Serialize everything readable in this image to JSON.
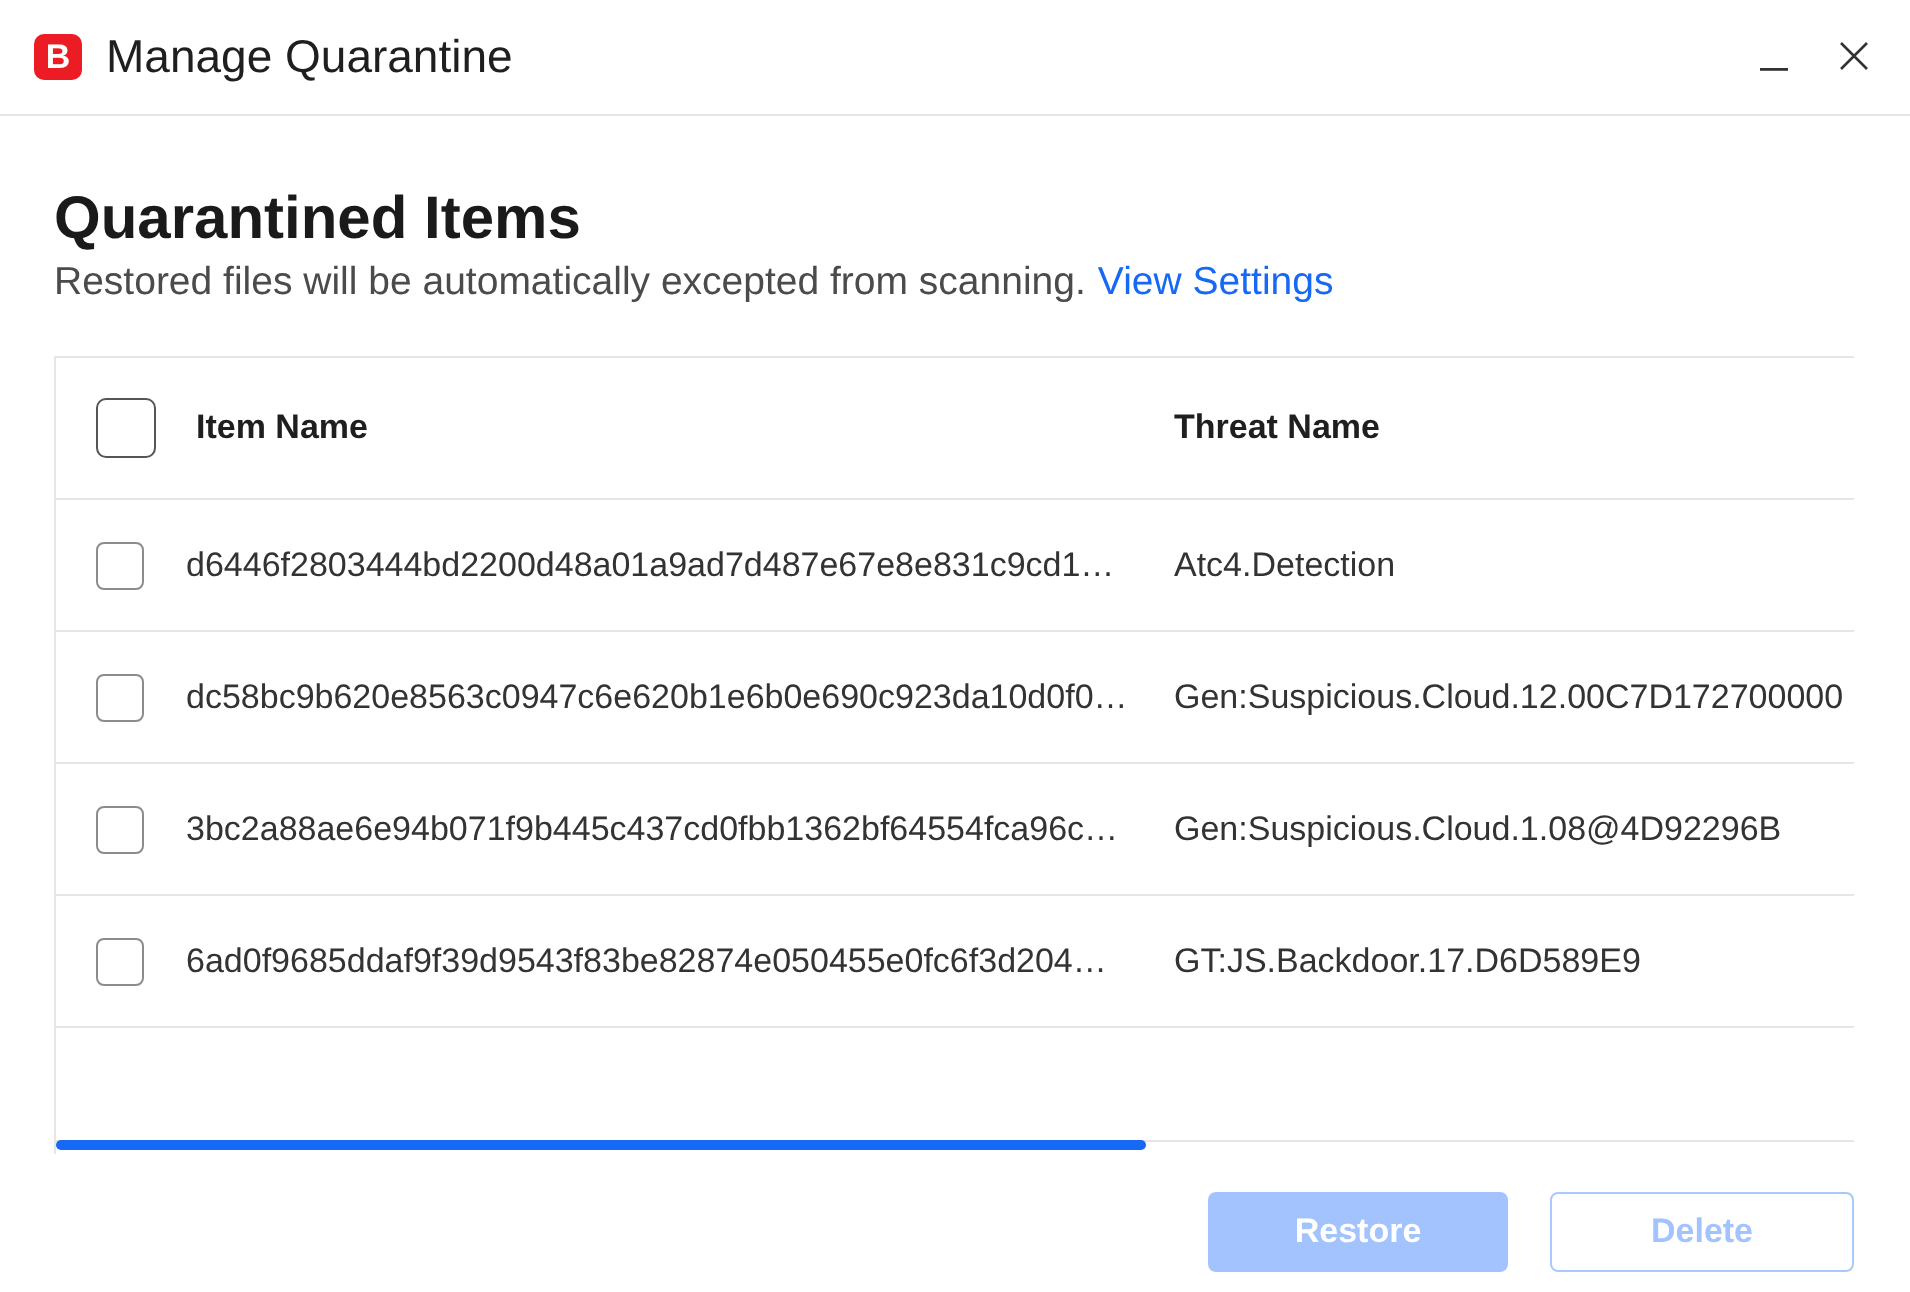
{
  "window": {
    "logo": "B",
    "title": "Manage Quarantine"
  },
  "header": {
    "title": "Quarantined Items",
    "description": "Restored files will be automatically excepted from scanning.",
    "link": "View Settings"
  },
  "table": {
    "select_all": {
      "checked": false
    },
    "columns": [
      "Item Name",
      "Threat Name"
    ],
    "rows": [
      {
        "checked": false,
        "item_name": "d6446f2803444bd2200d48a01a9ad7d487e67e8e831c9cd1…",
        "threat_name": "Atc4.Detection"
      },
      {
        "checked": false,
        "item_name": "dc58bc9b620e8563c0947c6e620b1e6b0e690c923da10d0f0…",
        "threat_name": "Gen:Suspicious.Cloud.12.00C7D172700000"
      },
      {
        "checked": false,
        "item_name": "3bc2a88ae6e94b071f9b445c437cd0fbb1362bf64554fca96c…",
        "threat_name": "Gen:Suspicious.Cloud.1.08@4D92296B"
      },
      {
        "checked": false,
        "item_name": "6ad0f9685ddaf9f39d9543f83be82874e050455e0fc6f3d204…",
        "threat_name": "GT:JS.Backdoor.17.D6D589E9"
      }
    ]
  },
  "buttons": [
    {
      "label": "Restore",
      "kind": "primary",
      "disabled": true
    },
    {
      "label": "Delete",
      "kind": "secondary",
      "disabled": true
    }
  ]
}
